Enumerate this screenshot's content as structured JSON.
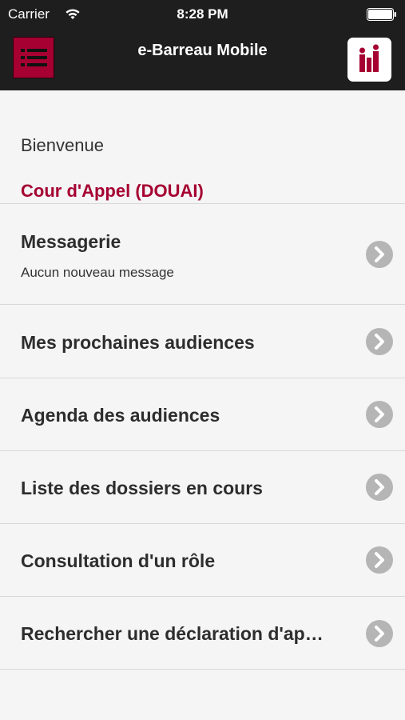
{
  "status_bar": {
    "carrier": "Carrier",
    "time": "8:28 PM"
  },
  "nav": {
    "title": "e-Barreau Mobile"
  },
  "header": {
    "welcome": "Bienvenue",
    "court": "Cour d'Appel (DOUAI)"
  },
  "menu": [
    {
      "label": "Messagerie",
      "sub": "Aucun nouveau message"
    },
    {
      "label": "Mes prochaines audiences"
    },
    {
      "label": "Agenda des audiences"
    },
    {
      "label": "Liste des dossiers en cours"
    },
    {
      "label": "Consultation d'un rôle"
    },
    {
      "label": "Rechercher une déclaration d'ap…"
    }
  ],
  "colors": {
    "accent": "#a50031",
    "topbar": "#1e1e1e",
    "background": "#f5f5f5"
  }
}
